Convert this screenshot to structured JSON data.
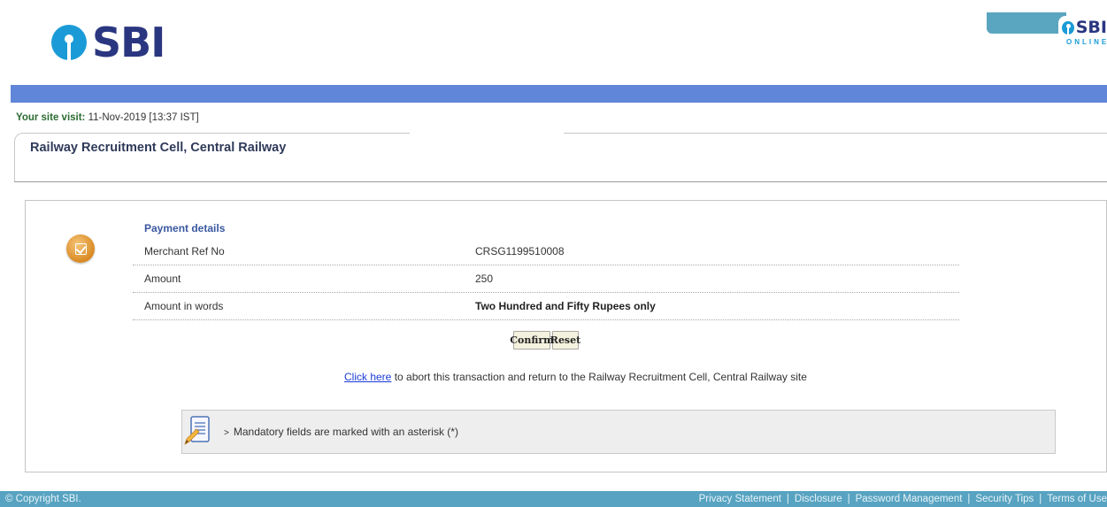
{
  "header": {
    "logo_text": "SBI",
    "corner_logo_text": "SBI",
    "corner_logo_sub": "ONLINE"
  },
  "site_visit": {
    "label": "Your site visit:",
    "value": "11-Nov-2019 [13:37 IST]"
  },
  "page": {
    "title": "Railway Recruitment Cell, Central Railway"
  },
  "payment": {
    "heading": "Payment details",
    "rows": [
      {
        "label": "Merchant Ref No",
        "value": "CRSG1199510008"
      },
      {
        "label": "Amount",
        "value": "250"
      },
      {
        "label": "Amount in words",
        "value": "Two Hundred and Fifty Rupees only"
      }
    ]
  },
  "buttons": {
    "confirm": "Confirm",
    "reset": "Reset"
  },
  "abort": {
    "link_text": "Click here",
    "rest_text": " to abort this transaction and return to the Railway Recruitment Cell, Central Railway site"
  },
  "notice": {
    "chevron": ">",
    "text": "Mandatory fields are marked with an asterisk (*)"
  },
  "footer": {
    "copyright": "© Copyright SBI.",
    "links": [
      "Privacy Statement",
      "Disclosure",
      "Password Management",
      "Security Tips",
      "Terms of Use"
    ],
    "separator": "|"
  },
  "colors": {
    "brand_navy": "#2a3680",
    "brand_blue": "#1a9bd7",
    "band_blue": "#5f86d8",
    "footer_teal": "#57a3c1"
  },
  "icons": [
    "sbi-logo-icon",
    "checkbox-badge-icon",
    "note-pencil-icon",
    "chevron-right-icon"
  ]
}
